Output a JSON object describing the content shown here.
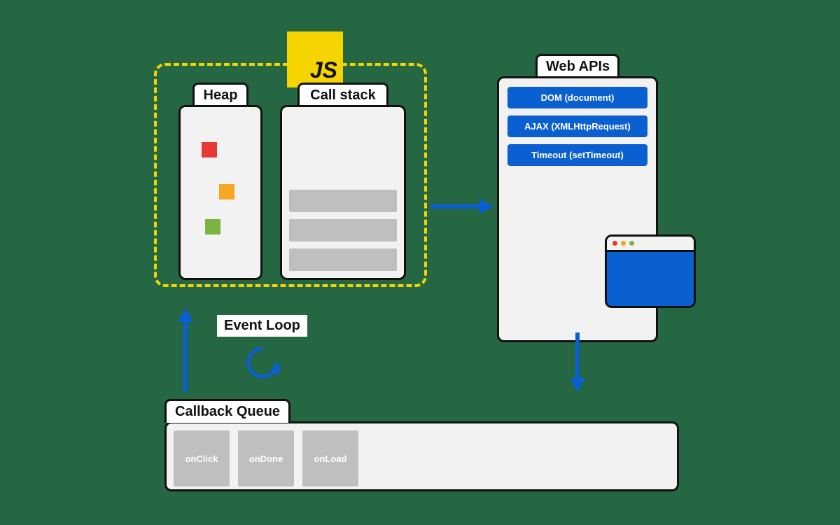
{
  "js_badge": "JS",
  "heap_label": "Heap",
  "stack_label": "Call stack",
  "webapis_label": "Web APIs",
  "webapis_items": {
    "dom": "DOM (document)",
    "ajax": "AJAX (XMLHttpRequest)",
    "timeout": "Timeout (setTimeout)"
  },
  "eventloop_label": "Event Loop",
  "queue_label": "Callback Queue",
  "callbacks": {
    "c1": "onClick",
    "c2": "onDone",
    "c3": "onLoad"
  },
  "colors": {
    "bg": "#246742",
    "accent_blue": "#0a5fd1",
    "js_yellow": "#f5d400"
  }
}
